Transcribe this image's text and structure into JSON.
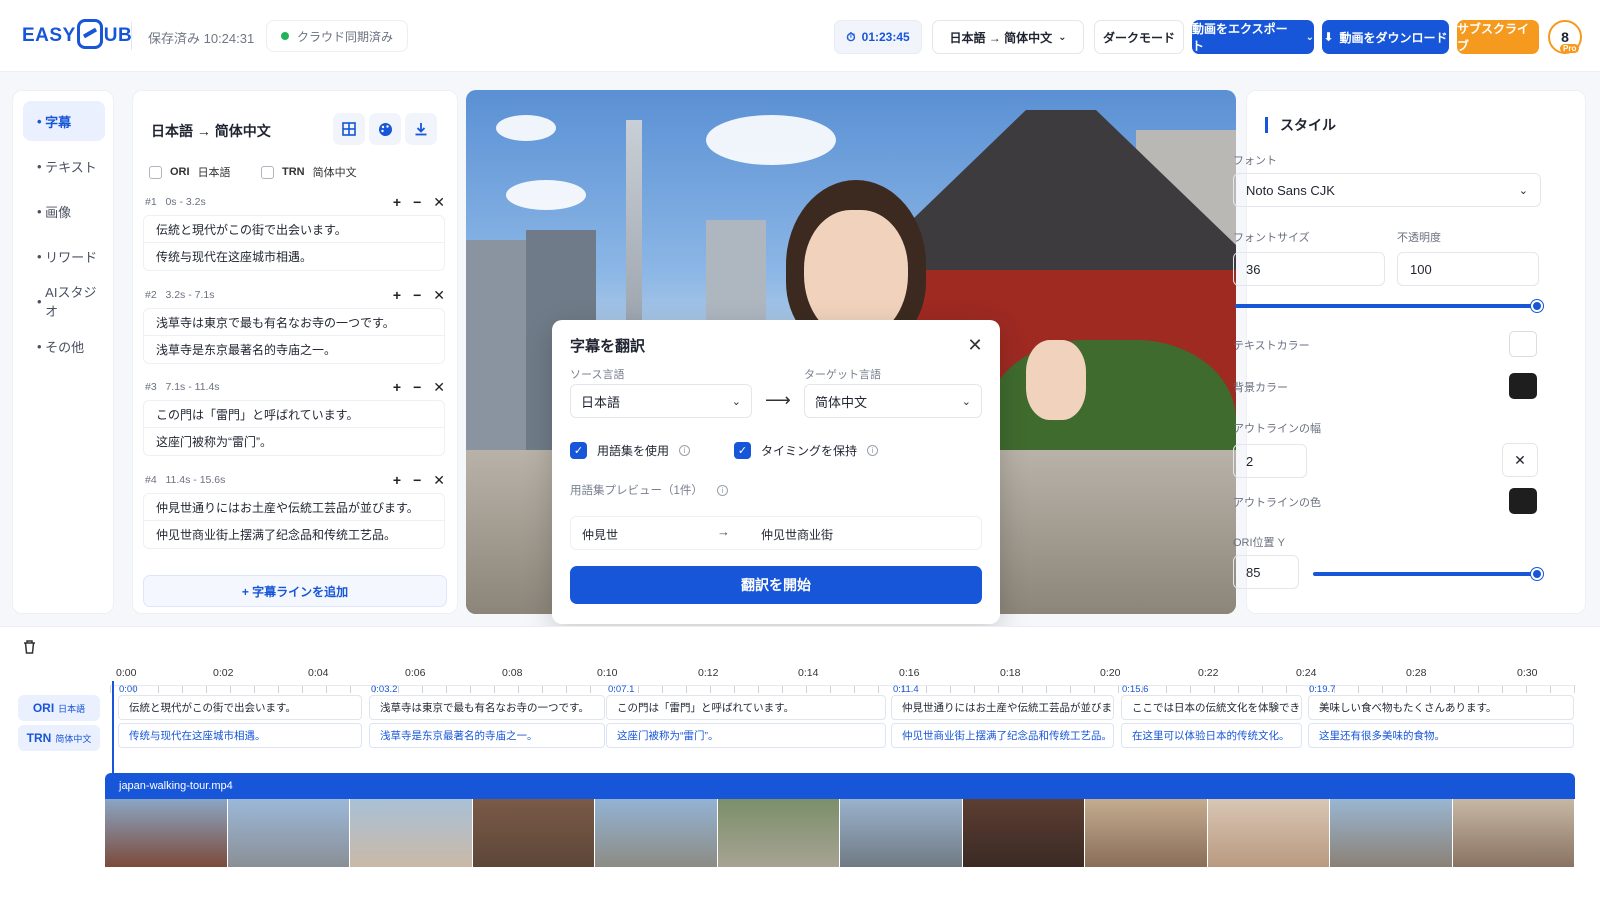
{
  "header": {
    "logo_left": "EASY",
    "logo_right": "UB",
    "saved": "保存済み 10:24:31",
    "sync": "クラウド同期済み",
    "timer": "01:23:45",
    "lang_selector": "日本語 → 简体中文",
    "dark_mode": "ダークモード",
    "export": "動画をエクスポート",
    "download": "動画をダウンロード",
    "subscribe": "サブスクライブ",
    "avatar_count": "8",
    "avatar_badge": "Pro"
  },
  "nav": {
    "items": [
      "字幕",
      "テキスト",
      "画像",
      "リワード",
      "AIスタジオ",
      "その他"
    ],
    "active": 0
  },
  "subtitles": {
    "title": "日本語 → 简体中文",
    "ori_label": "ORI",
    "ori_lang": "日本語",
    "trn_label": "TRN",
    "trn_lang": "简体中文",
    "cues": [
      {
        "id": "#1",
        "time": "0s - 3.2s",
        "ori": "伝統と現代がこの街で出会います。",
        "trn": "传统与现代在这座城市相遇。"
      },
      {
        "id": "#2",
        "time": "3.2s - 7.1s",
        "ori": "浅草寺は東京で最も有名なお寺の一つです。",
        "trn": "浅草寺是东京最著名的寺庙之一。"
      },
      {
        "id": "#3",
        "time": "7.1s - 11.4s",
        "ori": "この門は「雷門」と呼ばれています。",
        "trn": "这座门被称为“雷门”。"
      },
      {
        "id": "#4",
        "time": "11.4s - 15.6s",
        "ori": "仲見世通りにはお土産や伝統工芸品が並びます。",
        "trn": "仲见世商业街上摆满了纪念品和传统工艺品。"
      }
    ],
    "add_line": "+ 字幕ラインを追加"
  },
  "dialog": {
    "title": "字幕を翻訳",
    "source_label": "ソース言語",
    "source_value": "日本語",
    "target_label": "ターゲット言語",
    "target_value": "简体中文",
    "use_glossary": "用語集を使用",
    "keep_timing": "タイミングを保持",
    "glossary_preview": "用語集プレビュー（1件）",
    "gloss_src": "仲見世",
    "gloss_dst": "仲见世商业街",
    "start": "翻訳を開始"
  },
  "style": {
    "title": "スタイル",
    "font_label": "フォント",
    "font_value": "Noto Sans CJK",
    "size_label": "フォントサイズ",
    "size_value": "36",
    "opacity_label": "不透明度",
    "opacity_value": "100",
    "text_color_label": "テキストカラー",
    "text_color": "#ffffff",
    "bg_color_label": "背景カラー",
    "bg_color": "#1e1e1e",
    "outline_width_label": "アウトラインの幅",
    "outline_width_value": "2",
    "outline_color_label": "アウトラインの色",
    "outline_color": "#1e1e1e",
    "ori_pos_label": "ORI位置 Y",
    "ori_pos_value": "85"
  },
  "timeline": {
    "ticks": [
      "0:00",
      "0:02",
      "0:04",
      "0:06",
      "0:08",
      "0:10",
      "0:12",
      "0:14",
      "0:16",
      "0:18",
      "0:20",
      "0:22",
      "0:24",
      "0:28",
      "0:30"
    ],
    "ori_badge": "ORI",
    "ori_lang": "日本語",
    "trn_badge": "TRN",
    "trn_lang": "简体中文",
    "segments": [
      {
        "time": "0:00",
        "ori": "伝統と現代がこの街で出会います。",
        "trn": "传统与现代在这座城市相遇。"
      },
      {
        "time": "0:03.2",
        "ori": "浅草寺は東京で最も有名なお寺の一つです。",
        "trn": "浅草寺是东京最著名的寺庙之一。"
      },
      {
        "time": "0:07.1",
        "ori": "この門は「雷門」と呼ばれています。",
        "trn": "这座门被称为“雷门”。"
      },
      {
        "time": "0:11.4",
        "ori": "仲見世通りにはお土産や伝統工芸品が並びます。",
        "trn": "仲见世商业街上摆满了纪念品和传统工艺品。"
      },
      {
        "time": "0:15.6",
        "ori": "ここでは日本の伝統文化を体験できます。",
        "trn": "在这里可以体验日本的传统文化。"
      },
      {
        "time": "0:19.7",
        "ori": "美味しい食べ物もたくさんあります。",
        "trn": "这里还有很多美味的食物。"
      }
    ],
    "clip_name": "japan-walking-tour.mp4"
  },
  "colors": {
    "accent": "#1756d8",
    "subscribe": "#f59a1f",
    "sync_dot": "#22b35a"
  }
}
